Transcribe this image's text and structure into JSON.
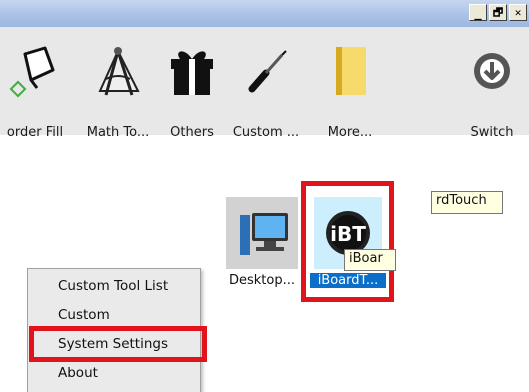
{
  "window": {
    "buttons": {
      "minimize": "_",
      "restore": "🗗",
      "close": "✕"
    }
  },
  "toolbar": {
    "items": [
      {
        "label": "order Fill",
        "icon": "border-fill-icon"
      },
      {
        "label": "Math To...",
        "icon": "math-tools-icon"
      },
      {
        "label": "Others",
        "icon": "gift-icon"
      },
      {
        "label": "Custom ...",
        "icon": "screwdriver-icon"
      },
      {
        "label": "More...",
        "icon": "folder-icon"
      },
      {
        "label": "Switch",
        "icon": "switch-down-arrow-icon"
      }
    ]
  },
  "desktop_icons": [
    {
      "label": "Desktop...",
      "icon": "desktop-computer-icon"
    },
    {
      "label": "iBoardT...",
      "icon": "iboardtouch-icon",
      "icon_text": "iBT",
      "highlighted": true
    }
  ],
  "tooltips": {
    "name_tooltip": "rdTouch",
    "hover_tooltip": "iBoar"
  },
  "context_menu": {
    "items": [
      {
        "label": "Custom Tool List"
      },
      {
        "label": "Custom"
      },
      {
        "label": "System Settings",
        "highlighted": true
      },
      {
        "label": "About"
      }
    ]
  },
  "colors": {
    "highlight": "#e0141a",
    "title_bar": "#a9c1e6",
    "toolbar_bg": "#e8e8e8"
  }
}
